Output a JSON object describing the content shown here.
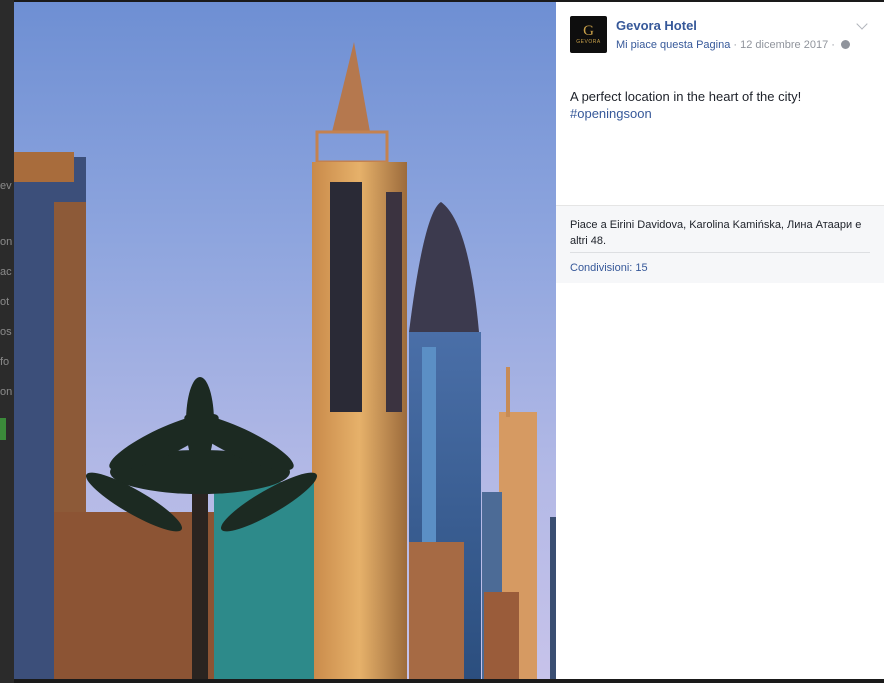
{
  "post": {
    "page_name": "Gevora Hotel",
    "like_page_label": "Mi piace questa Pagina",
    "separator": " · ",
    "date": "12 dicembre 2017",
    "separator2": " · ",
    "text_line": "A perfect location in the heart of the city!",
    "hashtag": "#openingsoon",
    "avatar_monogram": "G",
    "avatar_brand": "GEVORA"
  },
  "footer": {
    "likes_summary": "Piace a Eirini Davidova, Karolina Kamińska, Лина Атаари e altri 48.",
    "shares": "Condivisioni: 15"
  },
  "icons": {
    "options": "chevron-down-icon",
    "audience": "globe-icon"
  },
  "colors": {
    "link": "#365899",
    "text": "#1d2129",
    "meta": "#90949c",
    "footer_bg": "#f6f7f9",
    "avatar_gold": "#c9a14a"
  },
  "background_fragments": [
    "ev",
    "on",
    "ac",
    "ot",
    "os",
    "fo",
    "on"
  ]
}
